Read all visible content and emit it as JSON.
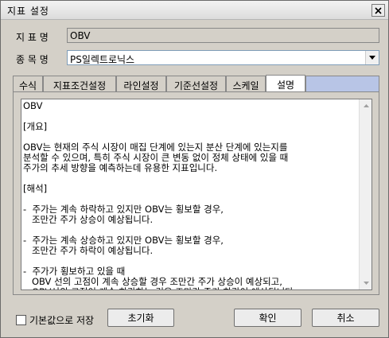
{
  "window": {
    "title": "지표 설정"
  },
  "form": {
    "indicator_label": "지 표 명",
    "indicator_value": "OBV",
    "stock_label": "종 목 명",
    "stock_value": "PS일렉트로닉스"
  },
  "tabs": [
    {
      "label": "수식"
    },
    {
      "label": "지표조건설정"
    },
    {
      "label": "라인설정"
    },
    {
      "label": "기준선설정"
    },
    {
      "label": "스케일"
    },
    {
      "label": "설명"
    }
  ],
  "active_tab": "설명",
  "description": {
    "text": "OBV\n\n[개요]\n\nOBV는 현재의 주식 시장이 매집 단계에 있는지 분산 단계에 있는지를\n분석할 수 있으며, 특히 주식 시장이 큰 변동 없이 정체 상태에 있을 때\n주가의 추세 방향을 예측하는데 유용한 지표입니다.\n\n[해석]\n\n-  주가는 계속 하락하고 있지만 OBV는 횡보할 경우,\n   조만간 주가 상승이 예상됩니다.\n\n-  주가는 계속 상승하고 있지만 OBV는 횡보할 경우,\n   조만간 주가 하락이 예상됩니다.\n\n-  주가가 횡보하고 있을 때\n   OBV 선의 고점이 계속 상승할 경우 조만간 주가 상승이 예상되고,\n   OBV선의 고점이 계속 하락하는 것은 조만간 주가 하락이 예상됩니다."
  },
  "footer": {
    "checkbox_label": "기본값으로 저장",
    "checkbox_checked": false,
    "reset_label": "초기화",
    "ok_label": "확인",
    "cancel_label": "취소"
  }
}
